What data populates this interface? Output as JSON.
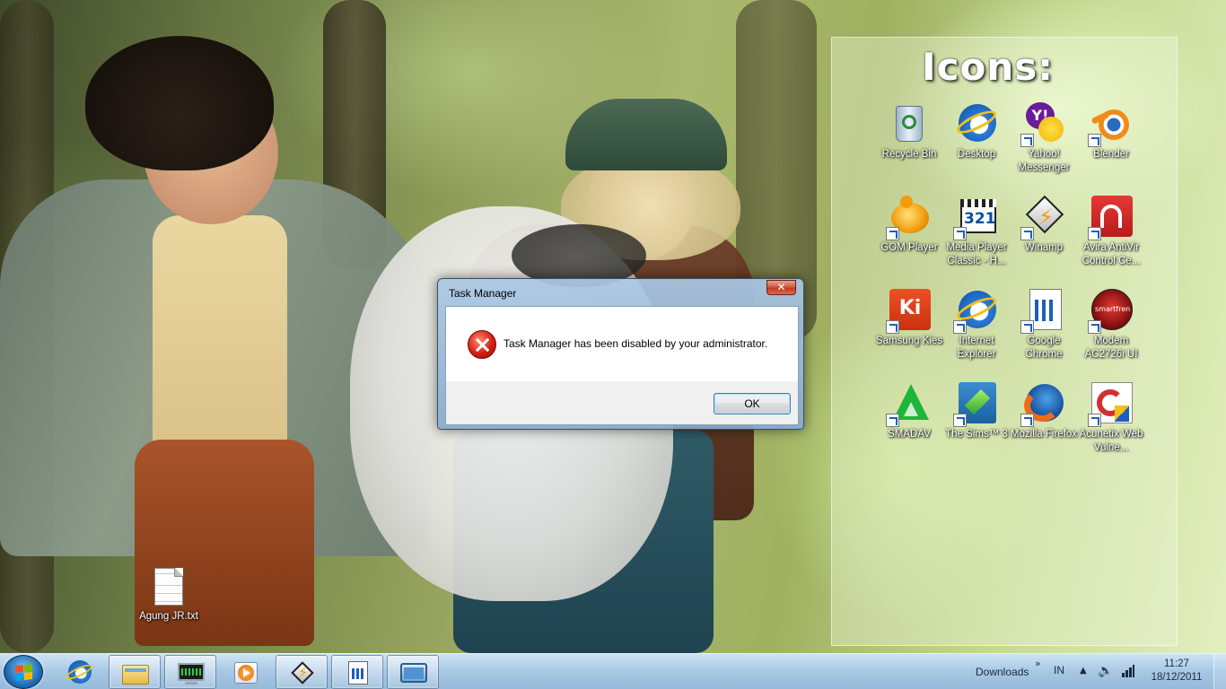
{
  "panel": {
    "title": "Icons:",
    "icons": [
      {
        "label": "Recycle Bin",
        "icon": "recycle-bin-icon"
      },
      {
        "label": "Desktop",
        "icon": "internet-explorer-icon"
      },
      {
        "label": "Yahoo! Messenger",
        "icon": "yahoo-messenger-icon"
      },
      {
        "label": "Blender",
        "icon": "blender-icon"
      },
      {
        "label": "GOM Player",
        "icon": "gom-player-icon"
      },
      {
        "label": "Media Player Classic - H...",
        "icon": "media-player-classic-icon"
      },
      {
        "label": "Winamp",
        "icon": "winamp-icon"
      },
      {
        "label": "Avira AntiVir Control Ce...",
        "icon": "avira-icon"
      },
      {
        "label": "Samsung Kies",
        "icon": "samsung-kies-icon"
      },
      {
        "label": "Internet Explorer",
        "icon": "internet-explorer-icon"
      },
      {
        "label": "Google Chrome",
        "icon": "google-chrome-icon"
      },
      {
        "label": "Modem AC2726i UI",
        "icon": "smartfren-modem-icon"
      },
      {
        "label": "SMADAV",
        "icon": "smadav-icon"
      },
      {
        "label": "The Sims™ 3",
        "icon": "the-sims-3-icon"
      },
      {
        "label": "Mozilla Firefox",
        "icon": "firefox-icon"
      },
      {
        "label": "Acunetix Web Vulne...",
        "icon": "acunetix-icon"
      }
    ]
  },
  "desktop_file": {
    "label": "Agung JR.txt",
    "icon": "text-file-icon"
  },
  "dialog": {
    "title": "Task Manager",
    "close": "✕",
    "message": "Task Manager has been disabled by your administrator.",
    "ok_label": "OK",
    "icon": "error-icon"
  },
  "taskbar": {
    "buttons": [
      {
        "name": "internet-explorer",
        "icon": "internet-explorer-icon",
        "active": false
      },
      {
        "name": "windows-explorer",
        "icon": "folder-icon",
        "active": true
      },
      {
        "name": "system-monitor",
        "icon": "monitor-icon",
        "active": true
      },
      {
        "name": "media-player",
        "icon": "media-player-icon",
        "active": false
      },
      {
        "name": "winamp",
        "icon": "winamp-icon",
        "active": true
      },
      {
        "name": "document",
        "icon": "document-icon",
        "active": true
      },
      {
        "name": "window",
        "icon": "window-icon",
        "active": true
      }
    ],
    "downloads": "Downloads",
    "chevron": "»",
    "language": "IN",
    "tray_arrow": "▲",
    "time": "11:27",
    "date": "18/12/2011"
  }
}
